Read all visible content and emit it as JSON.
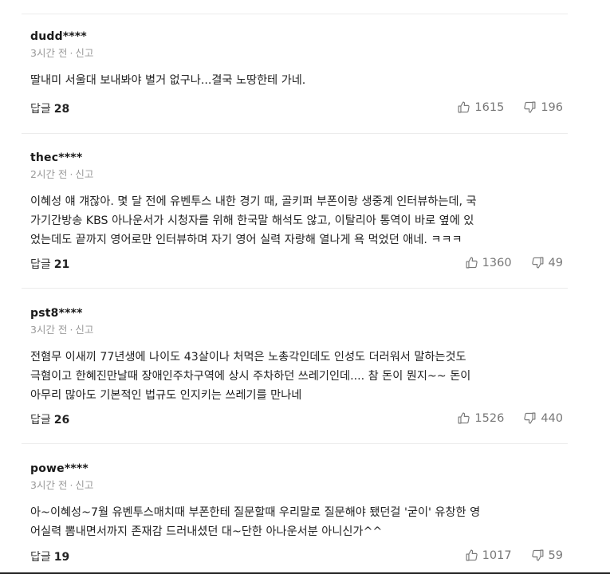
{
  "comments": [
    {
      "author": "dudd****",
      "time": "3시간 전",
      "report": "신고",
      "lines": [
        "딸내미 서울대 보내봐야 별거 없구나...결국 노땅한테 가네."
      ],
      "reply_label": "답글",
      "reply_count": "28",
      "likes": "1615",
      "dislikes": "196"
    },
    {
      "author": "thec****",
      "time": "2시간 전",
      "report": "신고",
      "lines": [
        "이혜성 얘 걔잖아. 몇 달 전에 유벤투스 내한 경기 때, 골키퍼 부폰이랑 생중계 인터뷰하는데, 국",
        "가기간방송 KBS 아나운서가 시청자를 위해 한국말 해석도 않고, 이탈리아 통역이 바로 옆에 있",
        "었는데도 끝까지 영어로만 인터뷰하며 자기 영어 실력 자랑해 열나게 욕 먹었던 애네. ㅋㅋㅋ"
      ],
      "reply_label": "답글",
      "reply_count": "21",
      "likes": "1360",
      "dislikes": "49"
    },
    {
      "author": "pst8****",
      "time": "3시간 전",
      "report": "신고",
      "lines": [
        "전혐무 이새끼 77년생에 나이도 43살이나 처먹은 노총각인데도 인성도 더러워서 말하는것도",
        "극혐이고 한혜진만날때 장애인주차구역에 상시 주차하던 쓰레기인데.... 참 돈이 뭔지~~ 돈이",
        "아무리 많아도 기본적인 법규도 인지키는 쓰레기를 만나네"
      ],
      "reply_label": "답글",
      "reply_count": "26",
      "likes": "1526",
      "dislikes": "440"
    },
    {
      "author": "powe****",
      "time": "3시간 전",
      "report": "신고",
      "lines": [
        "아~이혜성~7월 유벤투스매치때 부폰한테 질문할때 우리말로 질문해야 됐던걸 '굳이' 유창한 영",
        "어실력 뽐내면서까지 존재감 드러내셨던 대~단한 아나운서분 아니신가^^"
      ],
      "reply_label": "답글",
      "reply_count": "19",
      "likes": "1017",
      "dislikes": "59"
    }
  ]
}
